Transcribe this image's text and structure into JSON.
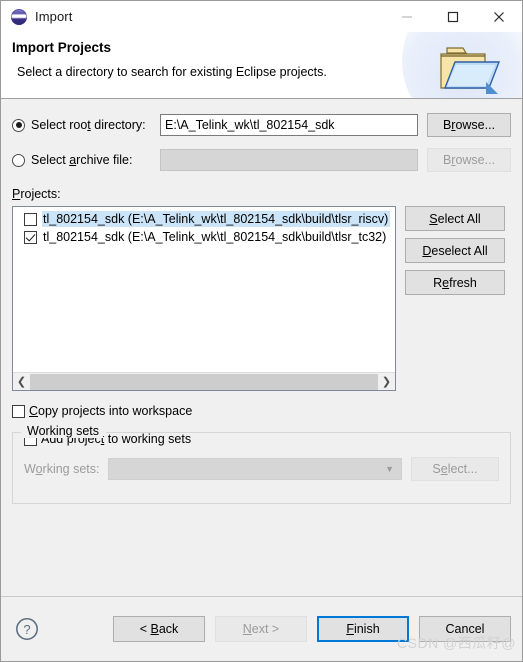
{
  "window": {
    "title": "Import",
    "icon": "eclipse-sphere-icon",
    "controls": {
      "minimize": "minimize-icon",
      "maximize": "maximize-icon",
      "close": "close-icon"
    }
  },
  "header": {
    "title": "Import Projects",
    "description": "Select a directory to search for existing Eclipse projects.",
    "icon": "open-folder-icon"
  },
  "source": {
    "root_directory": {
      "label": "Select root directory:",
      "selected": true,
      "value": "E:\\A_Telink_wk\\tl_802154_sdk",
      "placeholder": "",
      "browse_label": "Browse...",
      "browse_enabled": true
    },
    "archive_file": {
      "label": "Select archive file:",
      "selected": false,
      "value": "",
      "placeholder": "",
      "browse_label": "Browse...",
      "browse_enabled": false
    }
  },
  "projects": {
    "label": "Projects:",
    "items": [
      {
        "name": "tl_802154_sdk (E:\\A_Telink_wk\\tl_802154_sdk\\build\\tlsr_riscv)",
        "checked": false,
        "selected": true
      },
      {
        "name": "tl_802154_sdk (E:\\A_Telink_wk\\tl_802154_sdk\\build\\tlsr_tc32)",
        "checked": true,
        "selected": false
      }
    ],
    "buttons": {
      "select_all": "Select All",
      "deselect_all": "Deselect All",
      "refresh": "Refresh"
    },
    "scrollbar": {
      "left_arrow": "chevron-left-icon",
      "right_arrow": "chevron-right-icon"
    }
  },
  "options": {
    "copy_projects": {
      "label": "Copy projects into workspace",
      "checked": false
    }
  },
  "working_sets": {
    "group_title": "Working sets",
    "add_project": {
      "label": "Add project to working sets",
      "checked": false
    },
    "combo": {
      "label": "Working sets:",
      "value": "",
      "enabled": false
    },
    "select_button": {
      "label": "Select...",
      "enabled": false
    }
  },
  "footer": {
    "help": "help-icon",
    "buttons": [
      {
        "label": "< Back",
        "enabled": true,
        "default": false
      },
      {
        "label": "Next >",
        "enabled": false,
        "default": false
      },
      {
        "label": "Finish",
        "enabled": true,
        "default": true
      },
      {
        "label": "Cancel",
        "enabled": true,
        "default": false
      }
    ],
    "watermark": "CSDN @西瓜籽@"
  },
  "colors": {
    "accent": "#0078d7",
    "selection": "#cce4f7",
    "dialog_bg": "#f0f0f0"
  }
}
